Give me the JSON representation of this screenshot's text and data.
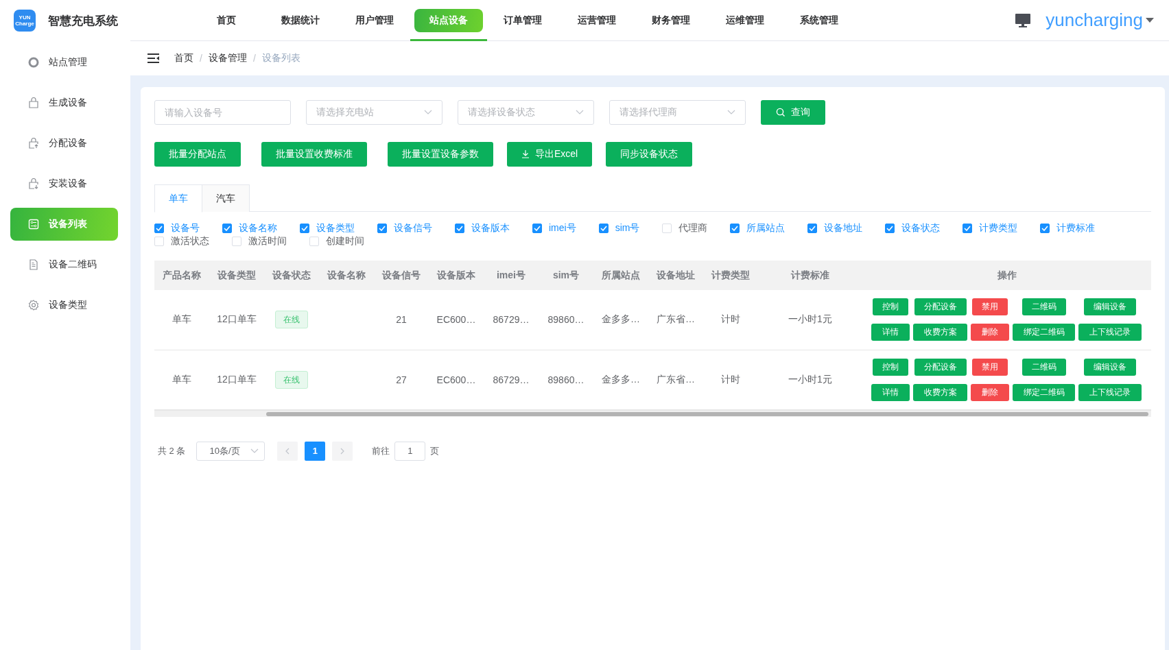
{
  "app": {
    "title": "智慧充电系统",
    "logo_text": "YUN",
    "logo_subtext": "Charge"
  },
  "nav": [
    {
      "label": "首页",
      "selected": false
    },
    {
      "label": "数据统计",
      "selected": false
    },
    {
      "label": "用户管理",
      "selected": false
    },
    {
      "label": "站点设备",
      "selected": true
    },
    {
      "label": "订单管理",
      "selected": false
    },
    {
      "label": "运营管理",
      "selected": false
    },
    {
      "label": "财务管理",
      "selected": false
    },
    {
      "label": "运维管理",
      "selected": false
    },
    {
      "label": "系统管理",
      "selected": false
    }
  ],
  "user": {
    "name": "yuncharging"
  },
  "sidebar": {
    "items": [
      {
        "label": "站点管理",
        "selected": false
      },
      {
        "label": "生成设备",
        "selected": false
      },
      {
        "label": "分配设备",
        "selected": false
      },
      {
        "label": "安装设备",
        "selected": false
      },
      {
        "label": "设备列表",
        "selected": true
      },
      {
        "label": "设备二维码",
        "selected": false
      },
      {
        "label": "设备类型",
        "selected": false
      }
    ]
  },
  "breadcrumb": {
    "items": [
      {
        "label": "首页",
        "current": false
      },
      {
        "label": "设备管理",
        "current": false
      },
      {
        "label": "设备列表",
        "current": true
      }
    ],
    "separators": [
      "/",
      "/"
    ]
  },
  "filters": [
    {
      "kind": "input",
      "placeholder": "请输入设备号"
    },
    {
      "kind": "select",
      "placeholder": "请选择充电站"
    },
    {
      "kind": "select",
      "placeholder": "请选择设备状态"
    },
    {
      "kind": "select",
      "placeholder": "请选择代理商"
    }
  ],
  "search_button": {
    "label": "查询"
  },
  "actions": [
    {
      "label": "批量分配站点",
      "kind": "plain"
    },
    {
      "label": "批量设置收费标准",
      "kind": "plain"
    },
    {
      "label": "批量设置设备参数",
      "kind": "plain"
    },
    {
      "label": "导出Excel",
      "kind": "download"
    },
    {
      "label": "同步设备状态",
      "kind": "plain"
    }
  ],
  "tabs": [
    {
      "label": "单车",
      "selected": true
    },
    {
      "label": "汽车",
      "selected": false
    }
  ],
  "column_options": [
    {
      "label": "设备号",
      "checked": true
    },
    {
      "label": "设备名称",
      "checked": true
    },
    {
      "label": "设备类型",
      "checked": true
    },
    {
      "label": "设备信号",
      "checked": true
    },
    {
      "label": "设备版本",
      "checked": true
    },
    {
      "label": "imei号",
      "checked": true
    },
    {
      "label": "sim号",
      "checked": true
    },
    {
      "label": "代理商",
      "checked": false
    },
    {
      "label": "所属站点",
      "checked": true
    },
    {
      "label": "设备地址",
      "checked": true
    },
    {
      "label": "设备状态",
      "checked": true
    },
    {
      "label": "计费类型",
      "checked": true
    },
    {
      "label": "计费标准",
      "checked": true
    },
    {
      "label": "激活状态",
      "checked": false
    },
    {
      "label": "激活时间",
      "checked": false
    },
    {
      "label": "创建时间",
      "checked": false
    }
  ],
  "table": {
    "columns": [
      "产品名称",
      "设备类型",
      "设备状态",
      "设备名称",
      "设备信号",
      "设备版本",
      "imei号",
      "sim号",
      "所属站点",
      "设备地址",
      "计费类型",
      "计费标准",
      "操作"
    ],
    "rows": [
      {
        "product": "单车",
        "type": "12口单车",
        "status": {
          "label": "在线",
          "online": true
        },
        "signal": "21",
        "version": "EC600…",
        "imei": "86729…",
        "sim": "89860…",
        "station": "金多多…",
        "address": "广东省…",
        "billing_type": "计时",
        "billing_standard": "一小时1元",
        "ops": [
          {
            "label": "控制",
            "kind": "primary"
          },
          {
            "label": "分配设备",
            "kind": "primary"
          },
          {
            "label": "禁用",
            "kind": "danger"
          },
          {
            "label": "二维码",
            "kind": "primary"
          },
          {
            "label": "编辑设备",
            "kind": "primary"
          },
          {
            "label": "详情",
            "kind": "primary"
          },
          {
            "label": "收费方案",
            "kind": "primary"
          },
          {
            "label": "删除",
            "kind": "danger"
          },
          {
            "label": "绑定二维码",
            "kind": "primary"
          },
          {
            "label": "上下线记录",
            "kind": "primary"
          }
        ]
      },
      {
        "product": "单车",
        "type": "12口单车",
        "status": {
          "label": "在线",
          "online": true
        },
        "signal": "27",
        "version": "EC600…",
        "imei": "86729…",
        "sim": "89860…",
        "station": "金多多…",
        "address": "广东省…",
        "billing_type": "计时",
        "billing_standard": "一小时1元",
        "ops": [
          {
            "label": "控制",
            "kind": "primary"
          },
          {
            "label": "分配设备",
            "kind": "primary"
          },
          {
            "label": "禁用",
            "kind": "danger"
          },
          {
            "label": "二维码",
            "kind": "primary"
          },
          {
            "label": "编辑设备",
            "kind": "primary"
          },
          {
            "label": "详情",
            "kind": "primary"
          },
          {
            "label": "收费方案",
            "kind": "primary"
          },
          {
            "label": "删除",
            "kind": "danger"
          },
          {
            "label": "绑定二维码",
            "kind": "primary"
          },
          {
            "label": "上下线记录",
            "kind": "primary"
          }
        ]
      }
    ]
  },
  "pagination": {
    "total": "共 2 条",
    "page_size": "10条/页",
    "pages": [
      {
        "label": "1",
        "selected": true
      }
    ],
    "goto_label": "前往",
    "goto_value": "1",
    "goto_suffix": "页"
  }
}
